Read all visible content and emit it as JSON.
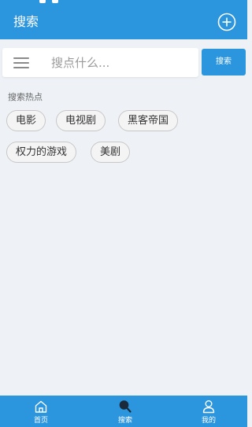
{
  "colors": {
    "primary": "#2b95de",
    "background": "#eef2f6",
    "tag_border": "#c7c7c7"
  },
  "app_bar": {
    "title": "搜索",
    "add_icon": "plus-circle-icon"
  },
  "search": {
    "menu_icon": "menu-icon",
    "placeholder": "搜点什么...",
    "value": "",
    "button_label": "搜索"
  },
  "hot": {
    "title": "搜索热点",
    "tags": [
      "电影",
      "电视剧",
      "黑客帝国",
      "权力的游戏",
      "美剧"
    ]
  },
  "bottom_nav": {
    "items": [
      {
        "label": "首页",
        "icon": "home-icon"
      },
      {
        "label": "搜索",
        "icon": "search-icon"
      },
      {
        "label": "我的",
        "icon": "user-icon"
      }
    ],
    "active_index": 1
  }
}
